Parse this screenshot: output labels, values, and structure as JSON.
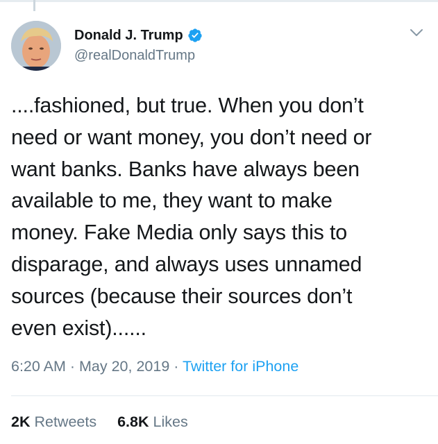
{
  "author": {
    "display_name": "Donald J. Trump",
    "handle": "@realDonaldTrump",
    "verified": true,
    "avatar_icon": "profile-photo",
    "verified_icon": "verified-badge-icon",
    "verified_color": "#1da1f2"
  },
  "tweet": {
    "lines": [
      "....fashioned, but true. When you don’t",
      "need or want money, you don’t need or",
      "want banks. Banks have always been",
      "available to me, they want to make",
      "money. Fake Media only says this to",
      "disparage, and always uses unnamed",
      "sources (because their sources don’t",
      "even exist)......"
    ]
  },
  "meta": {
    "time": "6:20 AM",
    "separator": " · ",
    "date": "May 20, 2019",
    "source": "Twitter for iPhone"
  },
  "stats": {
    "retweets_count": "2K",
    "retweets_label": "Retweets",
    "likes_count": "6.8K",
    "likes_label": "Likes"
  },
  "colors": {
    "text": "#14171a",
    "secondary": "#657786",
    "link": "#1da1f2",
    "divider": "#e1e8ed"
  }
}
